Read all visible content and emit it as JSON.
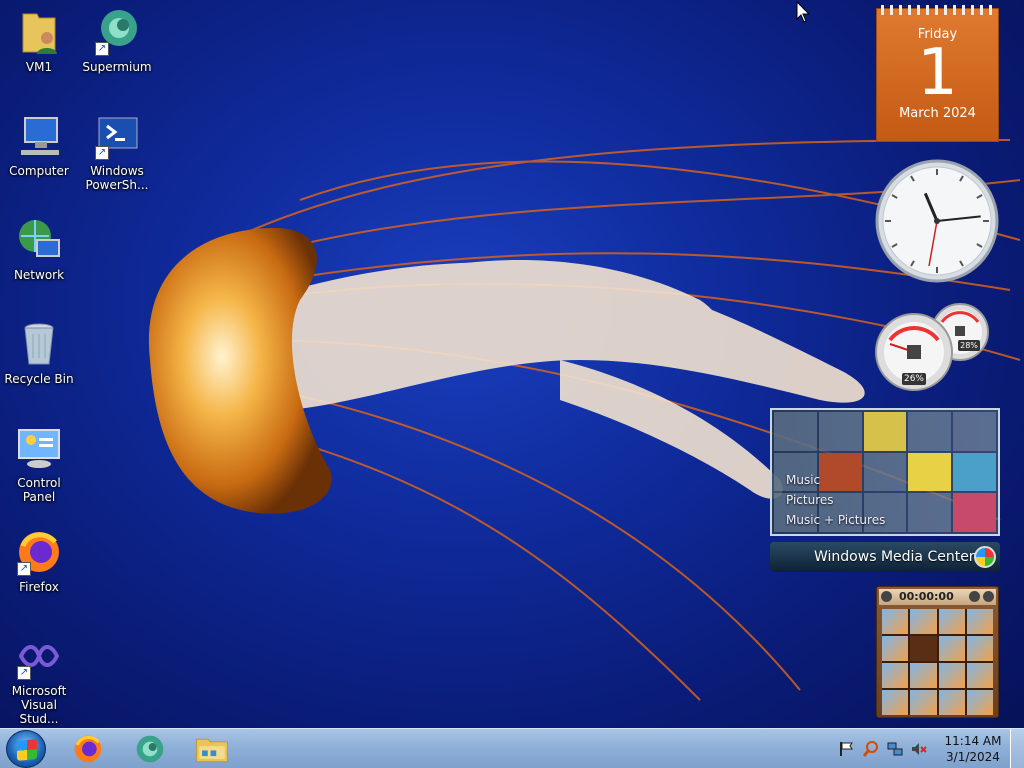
{
  "desktop": {
    "icons": [
      {
        "label": "VM1",
        "icon": "user-folder-icon"
      },
      {
        "label": "Supermium",
        "icon": "supermium-icon"
      },
      {
        "label": "Computer",
        "icon": "computer-icon"
      },
      {
        "label": "Windows PowerSh...",
        "icon": "powershell-icon"
      },
      {
        "label": "Network",
        "icon": "network-icon"
      },
      {
        "label": "Recycle Bin",
        "icon": "recycle-bin-icon"
      },
      {
        "label": "Control Panel",
        "icon": "control-panel-icon"
      },
      {
        "label": "Firefox",
        "icon": "firefox-icon"
      },
      {
        "label": "Microsoft Visual Stud...",
        "icon": "visual-studio-icon"
      }
    ]
  },
  "gadgets": {
    "calendar": {
      "weekday": "Friday",
      "day": "1",
      "month_year": "March 2024"
    },
    "clock": {
      "hour": 11,
      "minute": 14
    },
    "meter": {
      "cpu": "26%",
      "memory": "28%"
    },
    "media_center": {
      "items": [
        "Music",
        "Pictures",
        "Music + Pictures"
      ],
      "title": "Windows Media Center"
    },
    "puzzle": {
      "timer": "00:00:00"
    }
  },
  "taskbar": {
    "pinned": [
      "firefox-icon",
      "supermium-icon",
      "file-explorer-icon"
    ],
    "tray_icons": [
      "action-center-flag-icon",
      "search-icon",
      "network-icon",
      "volume-muted-icon"
    ],
    "time": "11:14 AM",
    "date": "3/1/2024"
  },
  "colors": {
    "calendar": "#d2651e",
    "taskbar": "#8fb0d8",
    "wallpaper": "#0f2a9a"
  }
}
